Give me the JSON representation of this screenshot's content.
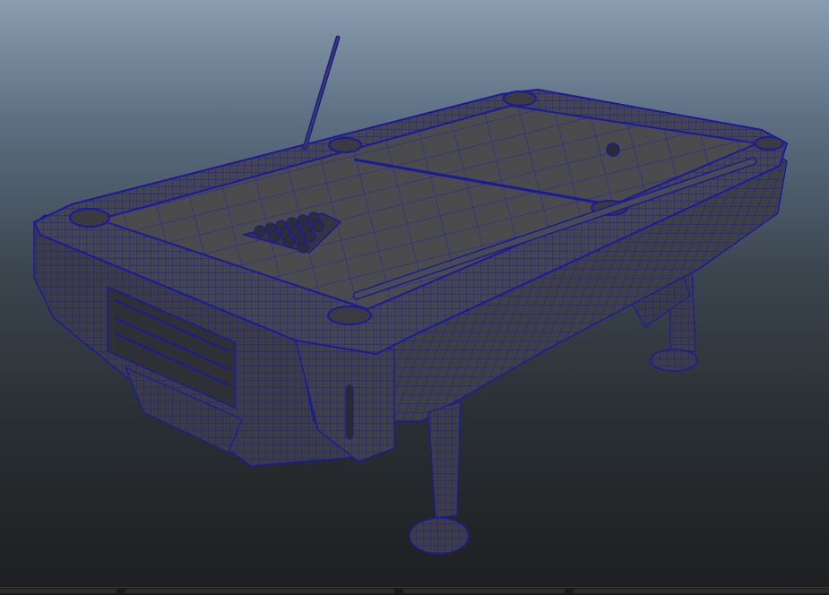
{
  "viewport": {
    "label": "",
    "background_top": "#8a9cb0",
    "background_bottom": "#1d1f21",
    "wire_color": "#1a1a9a",
    "surface_color": "#3f3f45",
    "felt_color": "#4a4a4c"
  },
  "model": {
    "objects": [
      "pool-table",
      "cue-stick",
      "ball-rack",
      "cue-ball",
      "table-legs",
      "ball-return-tray"
    ]
  }
}
